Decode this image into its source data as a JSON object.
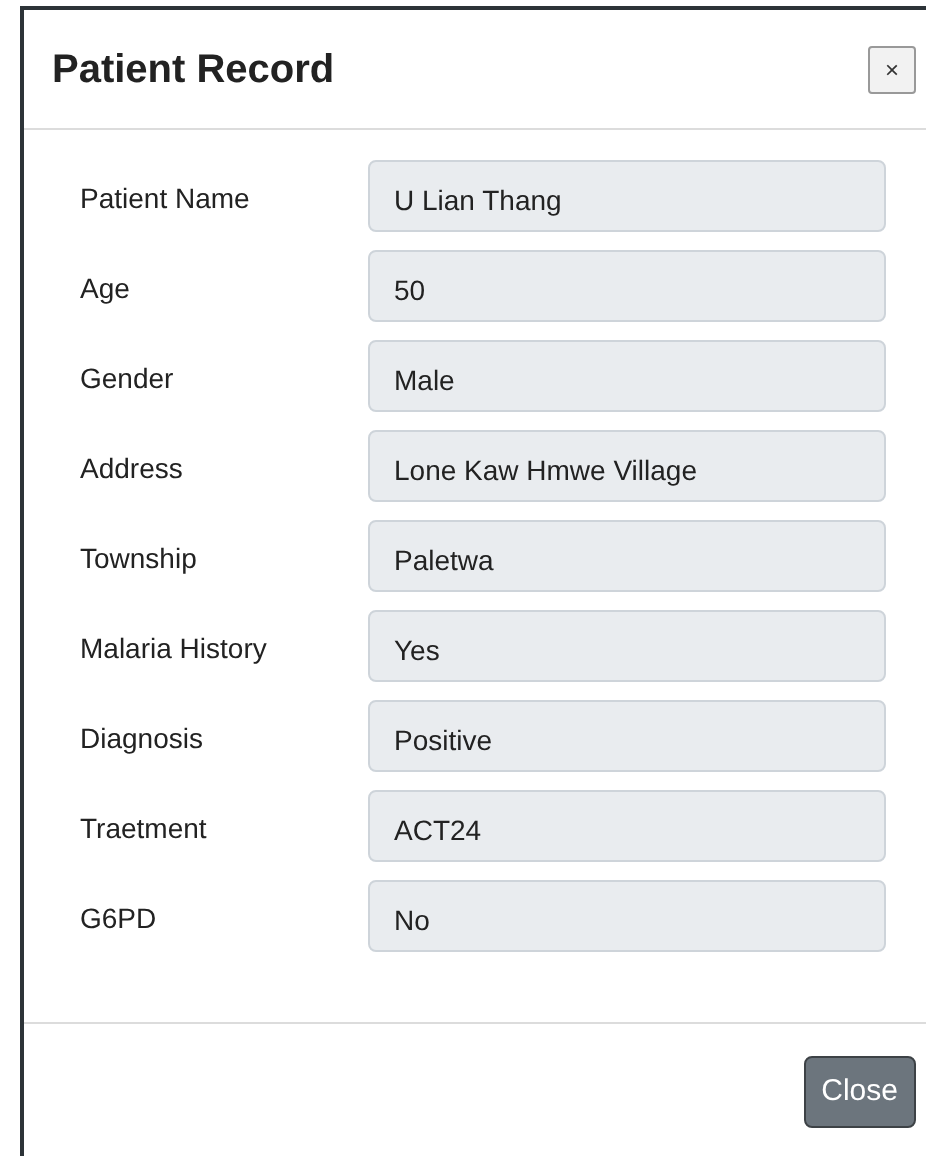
{
  "dialog": {
    "title": "Patient Record",
    "close_icon": "×"
  },
  "fields": [
    {
      "label": "Patient Name",
      "value": "U Lian Thang"
    },
    {
      "label": "Age",
      "value": "50"
    },
    {
      "label": "Gender",
      "value": "Male"
    },
    {
      "label": "Address",
      "value": "Lone Kaw Hmwe Village"
    },
    {
      "label": "Township",
      "value": "Paletwa"
    },
    {
      "label": "Malaria History",
      "value": "Yes"
    },
    {
      "label": "Diagnosis",
      "value": "Positive"
    },
    {
      "label": "Traetment",
      "value": "ACT24"
    },
    {
      "label": "G6PD",
      "value": "No"
    }
  ],
  "buttons": [
    "Close"
  ]
}
